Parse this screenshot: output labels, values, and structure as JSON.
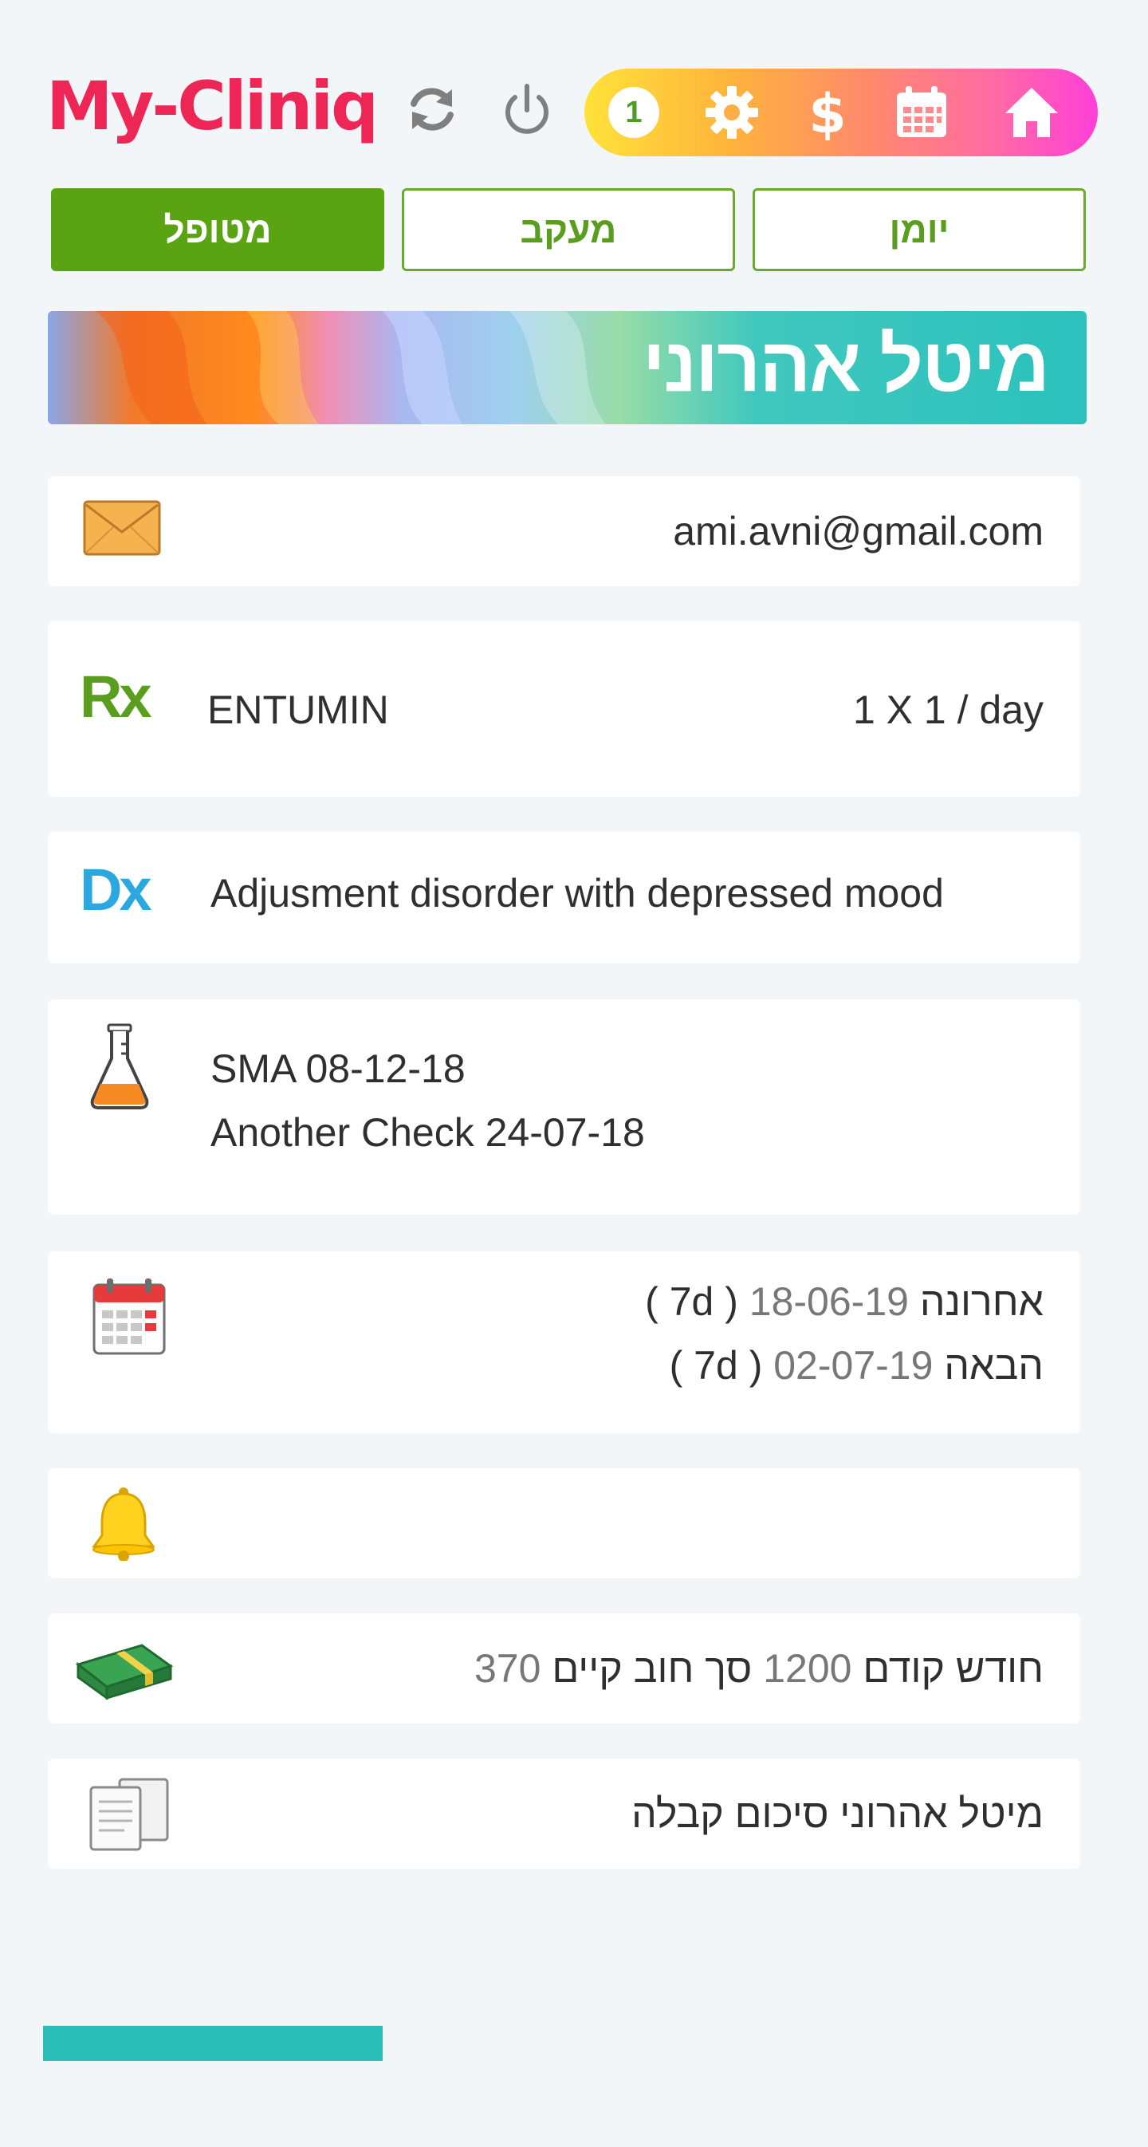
{
  "header": {
    "logo": "My-Cliniq",
    "badge_count": "1"
  },
  "tabs": [
    {
      "label": "מטופל",
      "active": true
    },
    {
      "label": "מעקב",
      "active": false
    },
    {
      "label": "יומן",
      "active": false
    }
  ],
  "banner": {
    "patient_name": "מיטל אהרוני"
  },
  "email": "ami.avni@gmail.com",
  "prescription": {
    "drug": "ENTUMIN",
    "dose": "1 X 1 / day"
  },
  "diagnosis": "Adjusment disorder with depressed mood",
  "lab_tests": [
    "SMA 08-12-18",
    "Another Check 24-07-18"
  ],
  "appointments": {
    "last_label": "אחרונה",
    "last_date": "18-06-19",
    "last_interval": "( 7d )",
    "next_label": "הבאה",
    "next_date": "02-07-19",
    "next_interval": "( 7d )"
  },
  "billing": {
    "prev_month_label": "חודש קודם",
    "prev_month_value": "1200",
    "debt_label": "סך חוב קיים",
    "debt_value": "370"
  },
  "receipt": "מיטל אהרוני סיכום קבלה",
  "colors": {
    "brand": "#ee2656",
    "accent_green": "#5aa413",
    "teal": "#2bbdb8"
  },
  "icons": [
    "refresh-icon",
    "power-icon",
    "gear-icon",
    "dollar-icon",
    "calendar-icon",
    "home-icon",
    "envelope-icon",
    "rx-icon",
    "dx-icon",
    "flask-icon",
    "calendar-card-icon",
    "bell-icon",
    "money-icon",
    "receipt-icon"
  ]
}
